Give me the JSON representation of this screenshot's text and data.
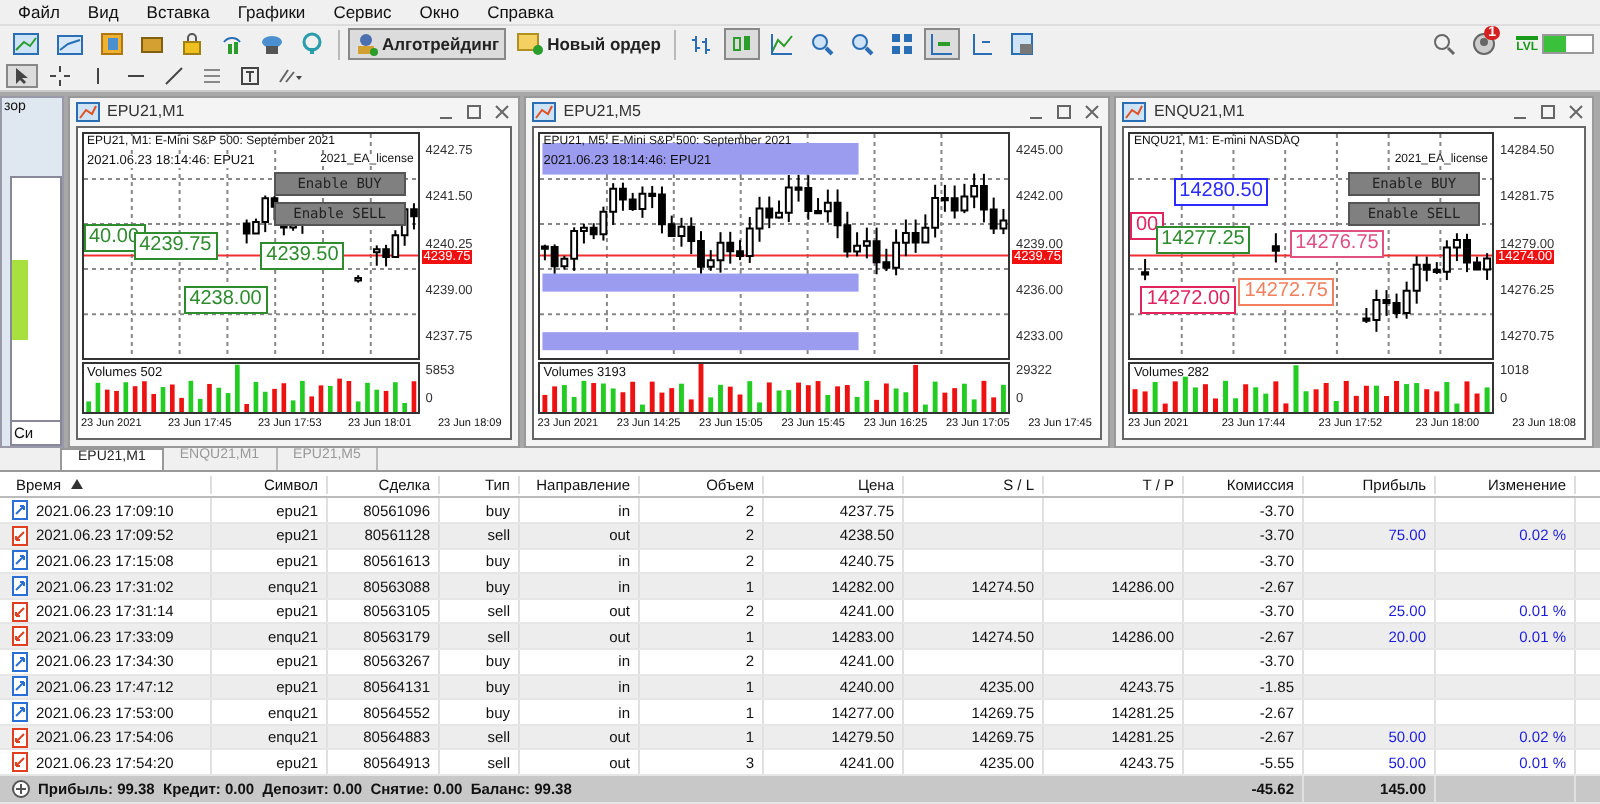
{
  "menu": [
    "Файл",
    "Вид",
    "Вставка",
    "Графики",
    "Сервис",
    "Окно",
    "Справка"
  ],
  "toolbar": {
    "tools": [
      {
        "kind": "chart",
        "pressed": false
      },
      {
        "kind": "profile",
        "pressed": false
      },
      {
        "kind": "market",
        "pressed": false
      },
      {
        "kind": "case",
        "pressed": false
      },
      {
        "kind": "lock",
        "pressed": false
      },
      {
        "kind": "signal",
        "pressed": false
      },
      {
        "kind": "cloud",
        "pressed": false
      },
      {
        "kind": "vps",
        "pressed": false
      }
    ],
    "buttons": [
      {
        "label": "Алготрейдинг",
        "pressed": true
      },
      {
        "label": "Новый ордер",
        "pressed": false
      }
    ],
    "chart_tools": [
      {
        "kind": "bars",
        "pressed": false
      },
      {
        "kind": "candles",
        "pressed": true
      },
      {
        "kind": "line",
        "pressed": false
      },
      {
        "kind": "zoomin",
        "pressed": false
      },
      {
        "kind": "zoomout",
        "pressed": false
      },
      {
        "kind": "tile",
        "pressed": false
      },
      {
        "kind": "autoscroll",
        "pressed": true
      },
      {
        "kind": "shift",
        "pressed": false
      },
      {
        "kind": "template",
        "pressed": false
      }
    ],
    "notifications": "1",
    "level_badge": "LVL"
  },
  "drawing_tools": [
    {
      "kind": "cursor",
      "pressed": true
    },
    {
      "kind": "crosshair",
      "pressed": false
    },
    {
      "kind": "vline",
      "pressed": false
    },
    {
      "kind": "hline",
      "pressed": false
    },
    {
      "kind": "trend",
      "pressed": false
    },
    {
      "kind": "fibo",
      "pressed": false
    },
    {
      "kind": "text",
      "pressed": false
    },
    {
      "kind": "shapes",
      "pressed": false
    }
  ],
  "left_panel": {
    "title": "зор",
    "tab": "Си"
  },
  "charts": [
    {
      "title": "EPU21,M1",
      "header": "EPU21, M1: E-Mini S&P 500: September 2021",
      "overlay": "2021_EA_license",
      "time_line": "2021.06.23 18:14:46: EPU21",
      "buttons": [
        "Enable BUY",
        "Enable SELL"
      ],
      "labels": [
        {
          "text": "40.00",
          "color": "#2e8b2e"
        },
        {
          "text": "4239.75",
          "color": "#2e8b2e"
        },
        {
          "text": "4239.50",
          "color": "#2e8b2e"
        },
        {
          "text": "4238.00",
          "color": "#2e8b2e"
        }
      ],
      "price_ticks": [
        "4242.75",
        "4241.50",
        "4240.25",
        "4239.00",
        "4237.75"
      ],
      "current_price": "4239.75",
      "volumes": "Volumes 502",
      "volume_ticks": [
        "5853",
        "0"
      ],
      "time_ticks": [
        "23 Jun 2021",
        "23 Jun 17:45",
        "23 Jun 17:53",
        "23 Jun 18:01",
        "23 Jun 18:09"
      ]
    },
    {
      "title": "EPU21,M5",
      "header": "EPU21, M5: E-Mini S&P 500: September 2021",
      "time_line": "2021.06.23 18:14:46: EPU21",
      "price_ticks": [
        "4245.00",
        "4242.00",
        "4239.00",
        "4236.00",
        "4233.00"
      ],
      "current_price": "4239.75",
      "volumes": "Volumes 3193",
      "volume_ticks": [
        "29322",
        "0"
      ],
      "time_ticks": [
        "23 Jun 2021",
        "23 Jun 14:25",
        "23 Jun 15:05",
        "23 Jun 15:45",
        "23 Jun 16:25",
        "23 Jun 17:05",
        "23 Jun 17:45"
      ]
    },
    {
      "title": "ENQU21,M1",
      "header": "ENQU21, M1: E-mini NASDAQ",
      "overlay": "2021_EA_license",
      "buttons": [
        "Enable BUY",
        "Enable SELL"
      ],
      "labels": [
        {
          "text": "14280.50",
          "color": "#2b2bff"
        },
        {
          "text": "00",
          "color": "#e0245e"
        },
        {
          "text": "14277.25",
          "color": "#2e8b2e"
        },
        {
          "text": "14276.75",
          "color": "#e05080"
        },
        {
          "text": "14272.00",
          "color": "#e0245e"
        },
        {
          "text": "14272.75",
          "color": "#f08060"
        }
      ],
      "price_ticks": [
        "14284.50",
        "14281.75",
        "14279.00",
        "14276.25",
        "14270.75"
      ],
      "current_price": "14274.00",
      "volumes": "Volumes 282",
      "volume_ticks": [
        "1018",
        "0"
      ],
      "time_ticks": [
        "23 Jun 2021",
        "23 Jun 17:44",
        "23 Jun 17:52",
        "23 Jun 18:00",
        "23 Jun 18:08"
      ]
    }
  ],
  "chart_tabs": [
    {
      "label": "EPU21,M1",
      "selected": true
    },
    {
      "label": "ENQU21,M1",
      "selected": false
    },
    {
      "label": "EPU21,M5",
      "selected": false
    }
  ],
  "table": {
    "columns": [
      {
        "label": "Время",
        "sorted": true
      },
      {
        "label": "Символ",
        "sorted": false
      },
      {
        "label": "Сделка",
        "sorted": false
      },
      {
        "label": "Тип",
        "sorted": false
      },
      {
        "label": "Направление",
        "sorted": false
      },
      {
        "label": "Объем",
        "sorted": false
      },
      {
        "label": "Цена",
        "sorted": false
      },
      {
        "label": "S / L",
        "sorted": false
      },
      {
        "label": "T / P",
        "sorted": false
      },
      {
        "label": "Комиссия",
        "sorted": false
      },
      {
        "label": "Прибыль",
        "sorted": false
      },
      {
        "label": "Изменение",
        "sorted": false
      }
    ],
    "rows": [
      {
        "kind": "buy",
        "cells": [
          "2021.06.23 17:09:10",
          "epu21",
          "80561096",
          "buy",
          "in",
          "2",
          "4237.75",
          "",
          "",
          "-3.70",
          "",
          ""
        ]
      },
      {
        "kind": "sell",
        "cells": [
          "2021.06.23 17:09:52",
          "epu21",
          "80561128",
          "sell",
          "out",
          "2",
          "4238.50",
          "",
          "",
          "-3.70",
          "75.00",
          "0.02 %"
        ]
      },
      {
        "kind": "buy",
        "cells": [
          "2021.06.23 17:15:08",
          "epu21",
          "80561613",
          "buy",
          "in",
          "2",
          "4240.75",
          "",
          "",
          "-3.70",
          "",
          ""
        ]
      },
      {
        "kind": "buy",
        "cells": [
          "2021.06.23 17:31:02",
          "enqu21",
          "80563088",
          "buy",
          "in",
          "1",
          "14282.00",
          "14274.50",
          "14286.00",
          "-2.67",
          "",
          ""
        ]
      },
      {
        "kind": "sell",
        "cells": [
          "2021.06.23 17:31:14",
          "epu21",
          "80563105",
          "sell",
          "out",
          "2",
          "4241.00",
          "",
          "",
          "-3.70",
          "25.00",
          "0.01 %"
        ]
      },
      {
        "kind": "sell",
        "cells": [
          "2021.06.23 17:33:09",
          "enqu21",
          "80563179",
          "sell",
          "out",
          "1",
          "14283.00",
          "14274.50",
          "14286.00",
          "-2.67",
          "20.00",
          "0.01 %"
        ]
      },
      {
        "kind": "buy",
        "cells": [
          "2021.06.23 17:34:30",
          "epu21",
          "80563267",
          "buy",
          "in",
          "2",
          "4241.00",
          "",
          "",
          "-3.70",
          "",
          ""
        ]
      },
      {
        "kind": "buy",
        "cells": [
          "2021.06.23 17:47:12",
          "epu21",
          "80564131",
          "buy",
          "in",
          "1",
          "4240.00",
          "4235.00",
          "4243.75",
          "-1.85",
          "",
          ""
        ]
      },
      {
        "kind": "buy",
        "cells": [
          "2021.06.23 17:53:00",
          "enqu21",
          "80564552",
          "buy",
          "in",
          "1",
          "14277.00",
          "14269.75",
          "14281.25",
          "-2.67",
          "",
          ""
        ]
      },
      {
        "kind": "sell",
        "cells": [
          "2021.06.23 17:54:06",
          "enqu21",
          "80564883",
          "sell",
          "out",
          "1",
          "14279.50",
          "14269.75",
          "14281.25",
          "-2.67",
          "50.00",
          "0.02 %"
        ]
      },
      {
        "kind": "sell",
        "cells": [
          "2021.06.23 17:54:20",
          "epu21",
          "80564913",
          "sell",
          "out",
          "3",
          "4241.00",
          "4235.00",
          "4243.75",
          "-5.55",
          "50.00",
          "0.01 %"
        ]
      }
    ],
    "summary": "Прибыль: 99.38  Кредит: 0.00  Депозит: 0.00  Снятие: 0.00  Баланс: 99.38",
    "total_commission": "-45.62",
    "total_profit": "145.00"
  }
}
